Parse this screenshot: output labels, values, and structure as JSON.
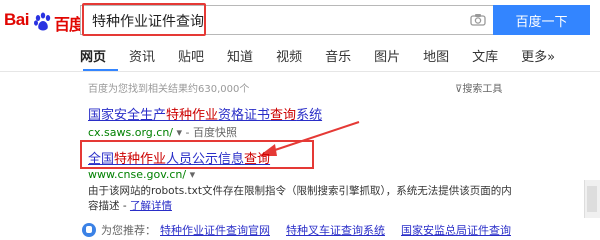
{
  "logo": {
    "text_left": "Bai",
    "text_right": "百度"
  },
  "search": {
    "query": "特种作业证件查询",
    "button_label": "百度一下",
    "camera_icon": "camera-icon"
  },
  "tabs": [
    "网页",
    "资讯",
    "贴吧",
    "知道",
    "视频",
    "音乐",
    "图片",
    "地图",
    "文库",
    "更多»"
  ],
  "stats": "百度为您找到相关结果约630,000个",
  "tools": "搜索工具",
  "results": [
    {
      "title_pre": "国家安全生产",
      "title_em": "特种作业",
      "title_mid": "资格证书",
      "title_em2": "查询",
      "title_post": "系统",
      "url": "cx.saws.org.cn/",
      "url_suffix": " - 百度快照"
    },
    {
      "title_pre": "全国",
      "title_em": "特种作业",
      "title_mid": "人员公示信息",
      "title_em2": "查询",
      "url": "www.cnse.gov.cn/",
      "snippet": "由于该网站的robots.txt文件存在限制指令（限制搜索引擎抓取），系统无法提供该页面的内容描述 - ",
      "snippet_link": "了解详情"
    }
  ],
  "recommend": {
    "label": "为您推荐：",
    "links": [
      "特种作业证件查询官网",
      "特种叉车证查询系统",
      "国家安监总局证件查询"
    ]
  },
  "colors": {
    "accent": "#3385ff",
    "highlight": "#e53935",
    "link": "#2a2ec8",
    "url": "#008000"
  }
}
